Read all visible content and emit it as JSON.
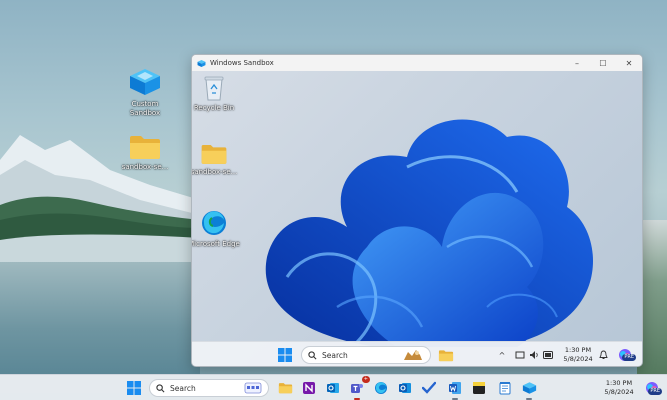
{
  "desktop": {
    "icons": [
      {
        "label": "Custom Sandbox"
      },
      {
        "label": "sandbox-se..."
      }
    ]
  },
  "sandbox_window": {
    "title": "Windows Sandbox",
    "controls": {
      "minimize": "–",
      "maximize": "☐",
      "close": "✕"
    },
    "desktop_icons": [
      {
        "label": "Recycle Bin"
      },
      {
        "label": "sandbox-se..."
      },
      {
        "label": "Microsoft Edge"
      }
    ],
    "taskbar": {
      "search_placeholder": "Search",
      "time": "1:30 PM",
      "date": "5/8/2024",
      "chevron": "^",
      "badge": "PRE"
    }
  },
  "host_taskbar": {
    "search_placeholder": "Search",
    "time": "1:30 PM",
    "date": "5/8/2024",
    "teams_badge": "+",
    "copilot_badge": "PRE"
  },
  "colors": {
    "accent": "#0078d4",
    "bloom": "#1f5fe0",
    "folder": "#f2c64b"
  }
}
